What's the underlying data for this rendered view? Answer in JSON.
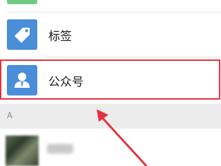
{
  "list": {
    "top_item": {
      "icon": "group-chat-icon"
    },
    "tags_item": {
      "label": "标签",
      "icon": "tag-icon"
    },
    "official_item": {
      "label": "公众号",
      "icon": "person-icon"
    }
  },
  "section_header": {
    "letter": "A"
  },
  "contact": {
    "icon": "avatar"
  },
  "colors": {
    "accent_blue": "#4a8dd9",
    "accent_green": "#6ecb84",
    "highlight_red": "#e3323d",
    "section_bg": "#ececec"
  }
}
